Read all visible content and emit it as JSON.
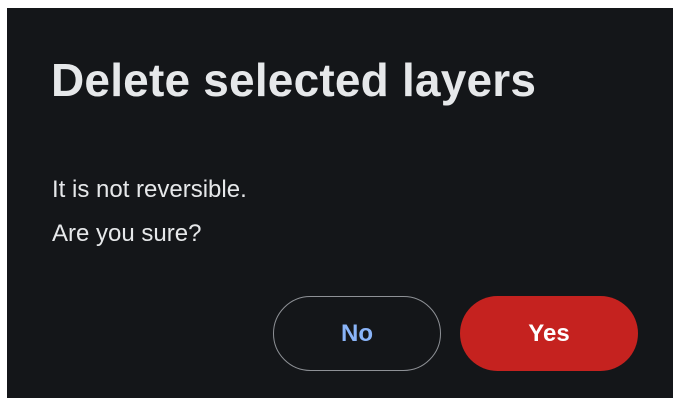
{
  "dialog": {
    "title": "Delete selected layers",
    "message_lines": [
      "It is not reversible.",
      "Are you sure?"
    ],
    "buttons": {
      "no_label": "No",
      "yes_label": "Yes"
    }
  },
  "colors": {
    "background": "#141619",
    "text": "#e6e8ea",
    "no_button_text": "#8ab4f8",
    "no_button_border": "#8e9196",
    "yes_button_fill": "#c5221f",
    "yes_button_text": "#ffffff"
  }
}
